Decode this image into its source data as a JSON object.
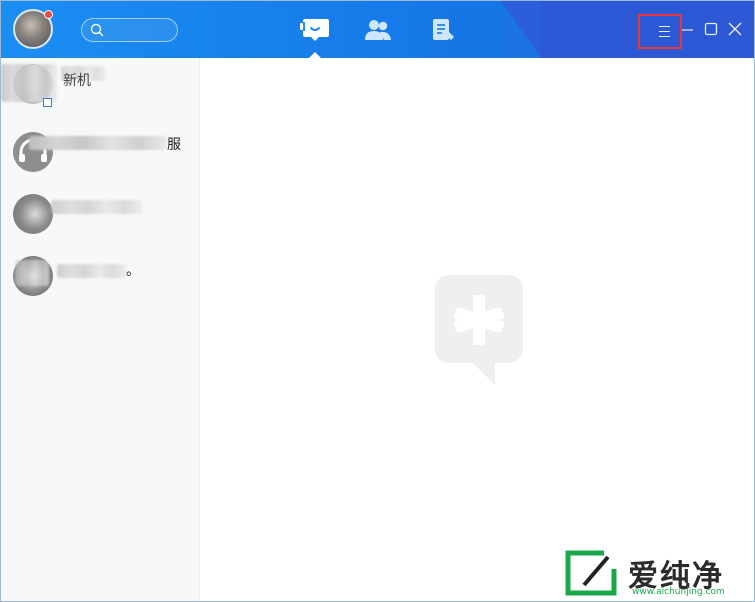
{
  "app": {
    "accent": "#1b8ef2",
    "menu_highlight_color": "#e8363c"
  },
  "header": {
    "search": {
      "placeholder": "",
      "value": ""
    },
    "tabs": [
      {
        "icon": "message-icon",
        "active": true
      },
      {
        "icon": "contacts-icon",
        "active": false
      },
      {
        "icon": "notes-icon",
        "active": false
      }
    ],
    "window_buttons": [
      "menu-icon",
      "minimize-icon",
      "maximize-icon",
      "close-icon"
    ]
  },
  "sidebar": {
    "chats": [
      {
        "name_visible": "新机",
        "avatar": "blurred-avatar"
      },
      {
        "name_visible": "服",
        "avatar": "headset-avatar"
      },
      {
        "name_visible": "",
        "avatar": "blurred-avatar"
      },
      {
        "name_visible": "。",
        "avatar": "blurred-avatar"
      }
    ]
  },
  "main": {
    "empty_state_icon": "asterisk-chat-logo-icon"
  },
  "watermark": {
    "text": "爱纯净",
    "url": "www.aichunjing.com",
    "color": "#1ba84a"
  }
}
